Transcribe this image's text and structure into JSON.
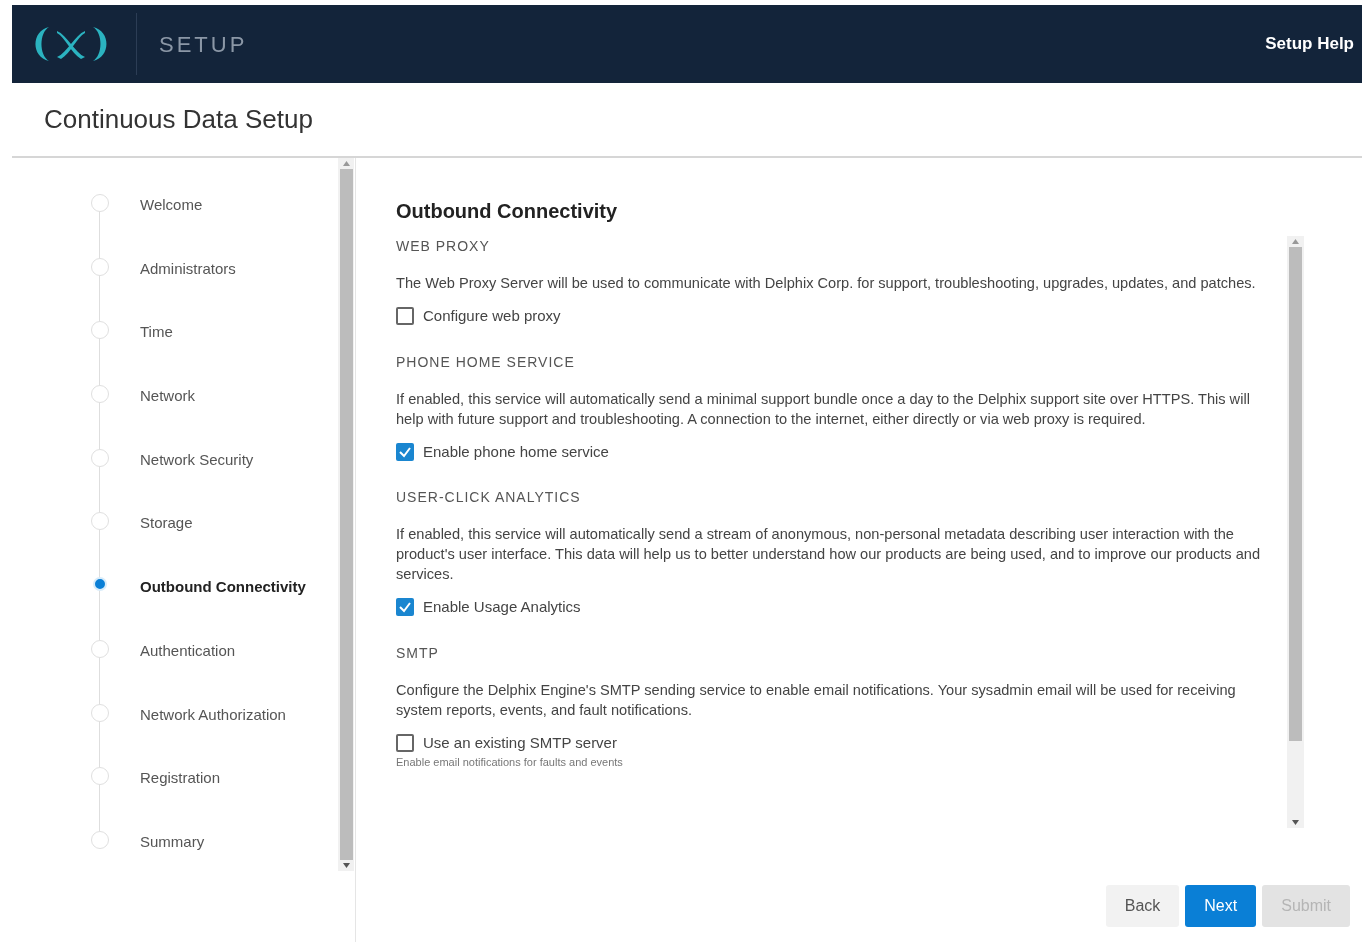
{
  "header": {
    "product": "SETUP",
    "help_link": "Setup Help"
  },
  "page_title": "Continuous Data Setup",
  "steps": [
    {
      "label": "Welcome",
      "selected": false
    },
    {
      "label": "Administrators",
      "selected": false
    },
    {
      "label": "Time",
      "selected": false
    },
    {
      "label": "Network",
      "selected": false
    },
    {
      "label": "Network Security",
      "selected": false
    },
    {
      "label": "Storage",
      "selected": false
    },
    {
      "label": "Outbound Connectivity",
      "selected": true
    },
    {
      "label": "Authentication",
      "selected": false
    },
    {
      "label": "Network Authorization",
      "selected": false
    },
    {
      "label": "Registration",
      "selected": false
    },
    {
      "label": "Summary",
      "selected": false
    }
  ],
  "section_title": "Outbound Connectivity",
  "sections": [
    {
      "heading": "WEB PROXY",
      "description": "The Web Proxy Server will be used to communicate with Delphix Corp. for support, troubleshooting, upgrades, updates, and patches.",
      "option": {
        "label": "Configure web proxy",
        "checked": false
      }
    },
    {
      "heading": "PHONE HOME SERVICE",
      "description": "If enabled, this service will automatically send a minimal support bundle once a day to the Delphix support site over HTTPS. This will help with future support and troubleshooting. A connection to the internet, either directly or via web proxy is required.",
      "option": {
        "label": "Enable phone home service",
        "checked": true
      }
    },
    {
      "heading": "USER-CLICK ANALYTICS",
      "description": "If enabled, this service will automatically send a stream of anonymous, non-personal metadata describing user interaction with the product's user interface. This data will help us to better understand how our products are being used, and to improve our products and services.",
      "option": {
        "label": "Enable Usage Analytics",
        "checked": true
      }
    },
    {
      "heading": "SMTP",
      "description": "Configure the Delphix Engine's SMTP sending service to enable email notifications. Your sysadmin email will be used for receiving system reports, events, and fault notifications.",
      "option": {
        "label": "Use an existing SMTP server",
        "checked": false
      },
      "hint": "Enable email notifications for faults and events"
    }
  ],
  "buttons": [
    {
      "label": "Back",
      "kind": "secondary"
    },
    {
      "label": "Next",
      "kind": "primary"
    },
    {
      "label": "Submit",
      "kind": "disabled"
    }
  ]
}
